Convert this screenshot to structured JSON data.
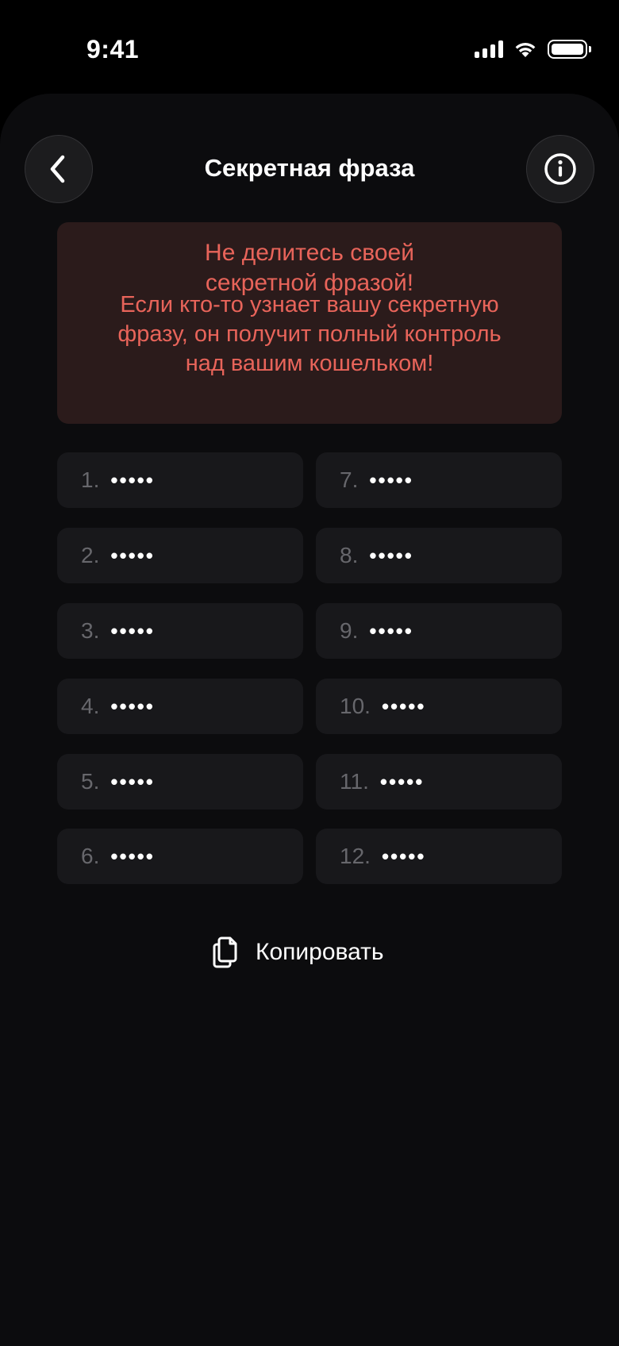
{
  "status": {
    "time": "9:41"
  },
  "header": {
    "title": "Секретная фраза"
  },
  "warning": {
    "title": "Не делитесь своей\nсекретной фразой!",
    "text": "Если кто-то узнает вашу секретную\nфразу, он получит полный контроль\nнад вашим кошельком!",
    "color": "#e8645a",
    "background": "#2b1b1b"
  },
  "words": [
    {
      "num": "1.",
      "mask": "•••••"
    },
    {
      "num": "2.",
      "mask": "•••••"
    },
    {
      "num": "3.",
      "mask": "•••••"
    },
    {
      "num": "4.",
      "mask": "•••••"
    },
    {
      "num": "5.",
      "mask": "•••••"
    },
    {
      "num": "6.",
      "mask": "•••••"
    },
    {
      "num": "7.",
      "mask": "•••••"
    },
    {
      "num": "8.",
      "mask": "•••••"
    },
    {
      "num": "9.",
      "mask": "•••••"
    },
    {
      "num": "10.",
      "mask": "•••••"
    },
    {
      "num": "11.",
      "mask": "•••••"
    },
    {
      "num": "12.",
      "mask": "•••••"
    }
  ],
  "copy": {
    "label": "Копировать",
    "icon": "copy-icon"
  },
  "icons": {
    "back": "chevron-left-icon",
    "info": "info-icon"
  }
}
